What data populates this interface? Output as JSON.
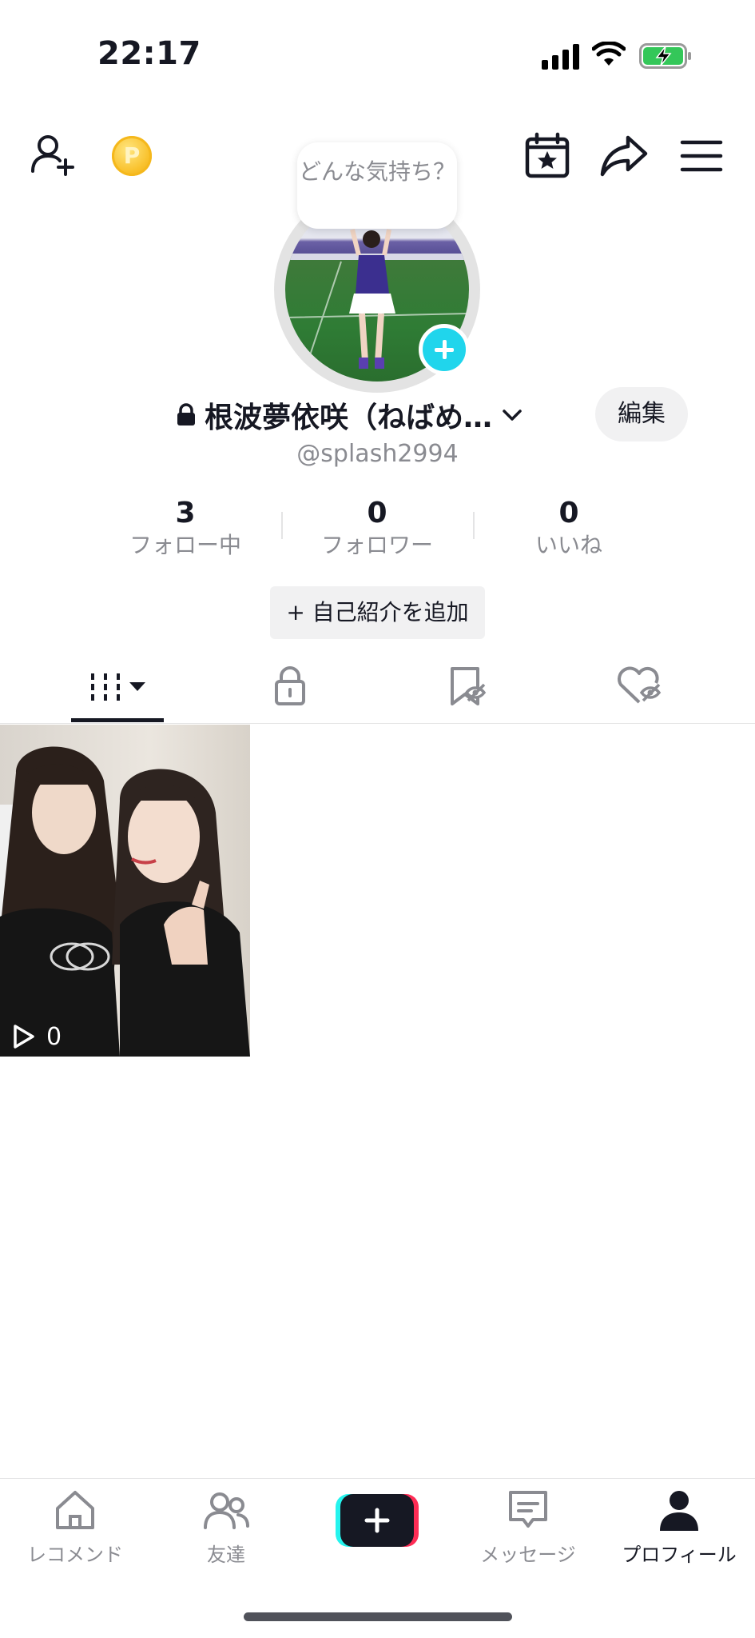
{
  "status_bar": {
    "time": "22:17"
  },
  "header": {
    "coin_letter": "P"
  },
  "profile": {
    "mood_prompt": "どんな気持ち？",
    "display_name": "根波夢依咲（ねばめ…",
    "username": "@splash2994",
    "edit_label": "編集"
  },
  "stats": [
    {
      "value": "3",
      "label": "フォロー中"
    },
    {
      "value": "0",
      "label": "フォロワー"
    },
    {
      "value": "0",
      "label": "いいね"
    }
  ],
  "bio_button_label": "+ 自己紹介を追加",
  "tabs": [
    {
      "icon": "grid-icon",
      "active": true
    },
    {
      "icon": "lock-icon"
    },
    {
      "icon": "hidden-bookmark-icon"
    },
    {
      "icon": "hidden-heart-icon"
    }
  ],
  "videos": [
    {
      "views": "0"
    }
  ],
  "bottom_nav": [
    {
      "label": "レコメンド",
      "icon": "home-icon"
    },
    {
      "label": "友達",
      "icon": "friends-icon"
    },
    {
      "label": "",
      "icon": "create-icon"
    },
    {
      "label": "メッセージ",
      "icon": "message-icon"
    },
    {
      "label": "プロフィール",
      "icon": "profile-icon",
      "active": true
    }
  ],
  "colors": {
    "accent": "#20d5ec",
    "brand_red": "#fe2c55",
    "text": "#161823",
    "secondary_text": "#8a8b91"
  }
}
